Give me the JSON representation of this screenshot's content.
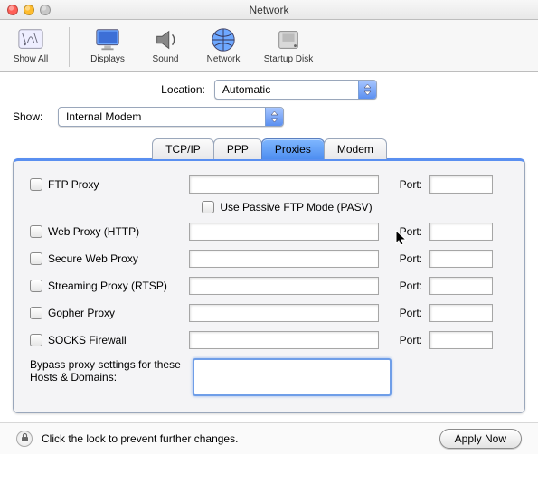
{
  "window": {
    "title": "Network"
  },
  "toolbar": {
    "items": [
      {
        "label": "Show All"
      },
      {
        "label": "Displays"
      },
      {
        "label": "Sound"
      },
      {
        "label": "Network"
      },
      {
        "label": "Startup Disk"
      }
    ]
  },
  "location": {
    "label": "Location:",
    "value": "Automatic"
  },
  "show": {
    "label": "Show:",
    "value": "Internal Modem"
  },
  "tabs": [
    {
      "label": "TCP/IP"
    },
    {
      "label": "PPP"
    },
    {
      "label": "Proxies"
    },
    {
      "label": "Modem"
    }
  ],
  "proxies": {
    "port_label": "Port:",
    "rows": [
      {
        "label": "FTP Proxy"
      },
      {
        "label": "Web Proxy (HTTP)"
      },
      {
        "label": "Secure Web Proxy"
      },
      {
        "label": "Streaming Proxy (RTSP)"
      },
      {
        "label": "Gopher Proxy"
      },
      {
        "label": "SOCKS Firewall"
      }
    ],
    "passive_label": "Use Passive FTP Mode (PASV)",
    "bypass_label": "Bypass proxy settings for these Hosts & Domains:"
  },
  "footer": {
    "lock_text": "Click the lock to prevent further changes.",
    "apply_label": "Apply Now"
  }
}
